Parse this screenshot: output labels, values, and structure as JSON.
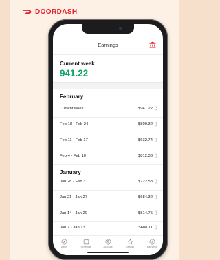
{
  "brand": {
    "name": "DOORDASH",
    "color": "#e5202f"
  },
  "header": {
    "title": "Earnings",
    "icon": "bank-icon"
  },
  "current_week": {
    "label": "Current week",
    "amount": "941.22",
    "color": "#11a565"
  },
  "sections": [
    {
      "month": "February",
      "rows": [
        {
          "label": "Current week",
          "value": "$941.22"
        },
        {
          "label": "Feb 18 - Feb 24",
          "value": "$800.32"
        },
        {
          "label": "Feb 11 - Feb 17",
          "value": "$632.74"
        },
        {
          "label": "Feb 4 - Feb 10",
          "value": "$812.33"
        }
      ]
    },
    {
      "month": "January",
      "rows": [
        {
          "label": "Jan 28 - Feb 3",
          "value": "$722.53"
        },
        {
          "label": "Jan 21 - Jan 27",
          "value": "$684.32"
        },
        {
          "label": "Jan 14 - Jan 20",
          "value": "$814.75"
        },
        {
          "label": "Jan 7 - Jan 13",
          "value": "$688.11"
        }
      ]
    }
  ],
  "tabs": [
    {
      "label": "Dash",
      "icon": "compass-icon"
    },
    {
      "label": "Schedule",
      "icon": "calendar-icon"
    },
    {
      "label": "Account",
      "icon": "account-icon"
    },
    {
      "label": "Ratings",
      "icon": "star-icon"
    },
    {
      "label": "Earnings",
      "icon": "dollar-icon"
    }
  ]
}
